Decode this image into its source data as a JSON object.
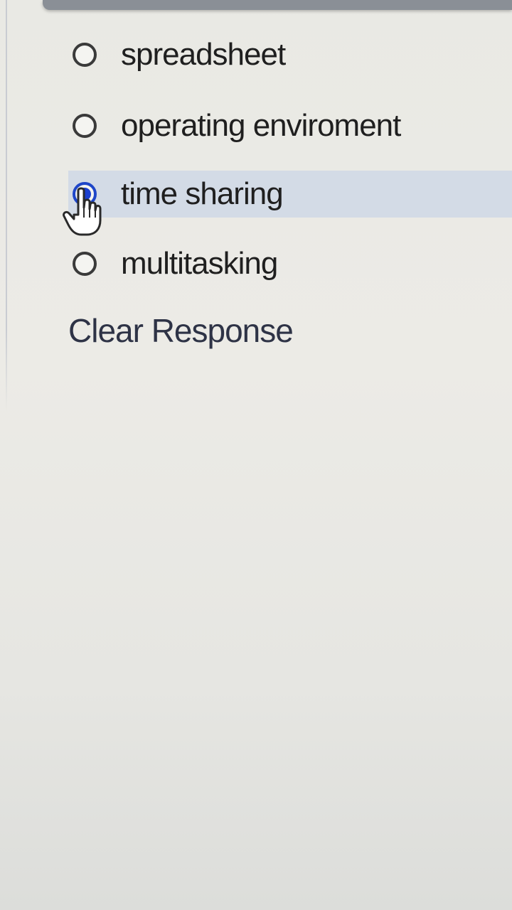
{
  "question": {
    "options": [
      {
        "label": "spreadsheet",
        "selected": false
      },
      {
        "label": "operating enviroment",
        "selected": false
      },
      {
        "label": "time sharing",
        "selected": true
      },
      {
        "label": "multitasking",
        "selected": false
      }
    ],
    "clear_label": "Clear Response"
  },
  "colors": {
    "selected_row": "#d3dbe6",
    "radio_checked": "#1a3fcf",
    "text": "#1f1f1f"
  },
  "icons": {
    "cursor": "hand-pointer-icon"
  }
}
